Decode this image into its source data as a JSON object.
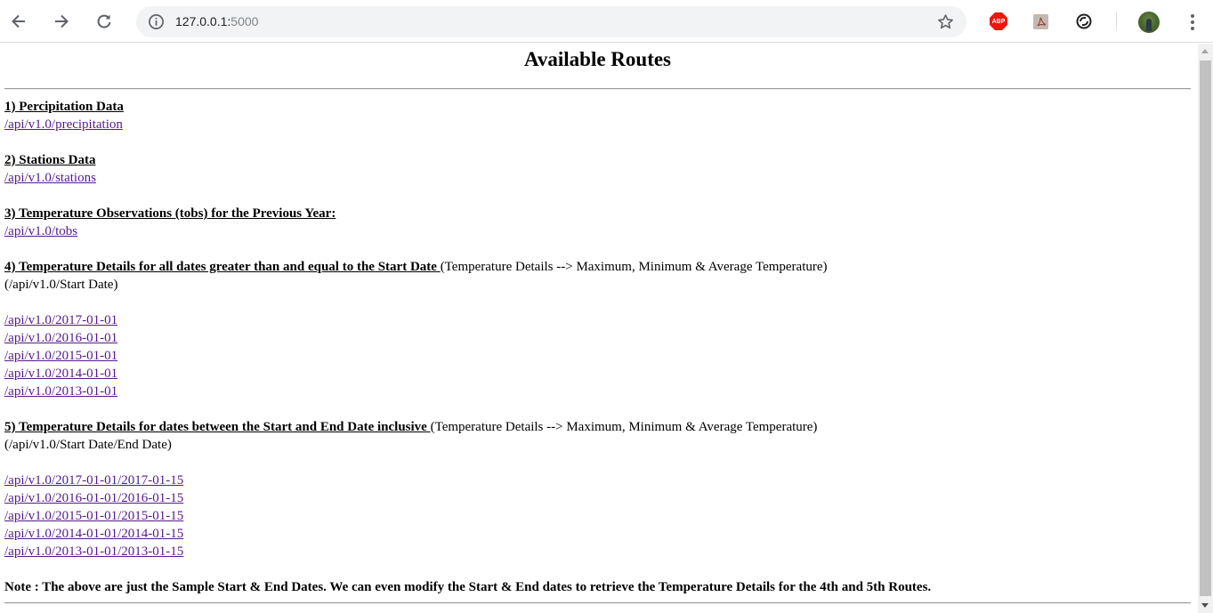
{
  "browser": {
    "url_host": "127.0.0.1:",
    "url_port": "5000",
    "abp_label": "ABP",
    "icons": [
      "back-arrow-icon",
      "forward-arrow-icon",
      "reload-icon",
      "info-icon",
      "star-icon",
      "adblock-plus-icon",
      "pdf-icon",
      "extension-icon",
      "profile-avatar",
      "more-menu-icon"
    ]
  },
  "page": {
    "title": "Available Routes",
    "sections": [
      {
        "heading": "1) Percipitation Data",
        "links": [
          "/api/v1.0/precipitation"
        ]
      },
      {
        "heading": "2) Stations Data",
        "links": [
          "/api/v1.0/stations"
        ]
      },
      {
        "heading": "3) Temperature Observations (tobs) for the Previous Year:",
        "links": [
          "/api/v1.0/tobs"
        ]
      },
      {
        "heading": "4) Temperature Details for all dates greater than and equal to the Start Date ",
        "detail": "(Temperature Details --> Maximum, Minimum & Average Temperature)",
        "format": "(/api/v1.0/Start Date)",
        "links": [
          "/api/v1.0/2017-01-01",
          "/api/v1.0/2016-01-01",
          "/api/v1.0/2015-01-01",
          "/api/v1.0/2014-01-01",
          "/api/v1.0/2013-01-01"
        ]
      },
      {
        "heading": "5) Temperature Details for dates between the Start and End Date inclusive ",
        "detail": "(Temperature Details --> Maximum, Minimum & Average Temperature)",
        "format": "(/api/v1.0/Start Date/End Date)",
        "links": [
          "/api/v1.0/2017-01-01/2017-01-15",
          "/api/v1.0/2016-01-01/2016-01-15",
          "/api/v1.0/2015-01-01/2015-01-15",
          "/api/v1.0/2014-01-01/2014-01-15",
          "/api/v1.0/2013-01-01/2013-01-15"
        ]
      }
    ],
    "note": "Note : The above are just the Sample Start & End Dates. We can even modify the Start & End dates to retrieve the Temperature Details for the 4th and 5th Routes."
  },
  "colors": {
    "link_visited": "#551a8b",
    "omnibox_bg": "#f1f3f4",
    "abp_red": "#e8190f"
  }
}
